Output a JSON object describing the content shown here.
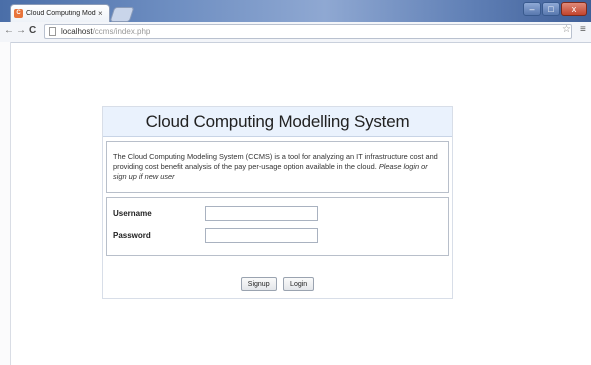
{
  "browser": {
    "tab_title": "Cloud Computing Model",
    "tab_close": "×",
    "favicon_glyph": "C",
    "url_host": "localhost",
    "url_path": "/ccms/index.php",
    "back_glyph": "←",
    "forward_glyph": "→",
    "reload_glyph": "C",
    "star_glyph": "☆",
    "menu_glyph": "≡",
    "minimize_glyph": "–",
    "maximize_glyph": "□",
    "close_glyph": "x",
    "titlebar_color": "#5f7fb5"
  },
  "page": {
    "heading": "Cloud Computing Modelling System",
    "description_main": "The Cloud Computing Modeling System (CCMS) is a tool for analyzing an IT infrastructure cost and providing cost benefit analysis of the pay per-usage option available in the cloud.",
    "description_hint": "Please login or sign up if new user",
    "username_label": "Username",
    "password_label": "Password",
    "username_value": "",
    "password_value": "",
    "signup_label": "Signup",
    "login_label": "Login",
    "header_bg": "#eaf2fd"
  }
}
